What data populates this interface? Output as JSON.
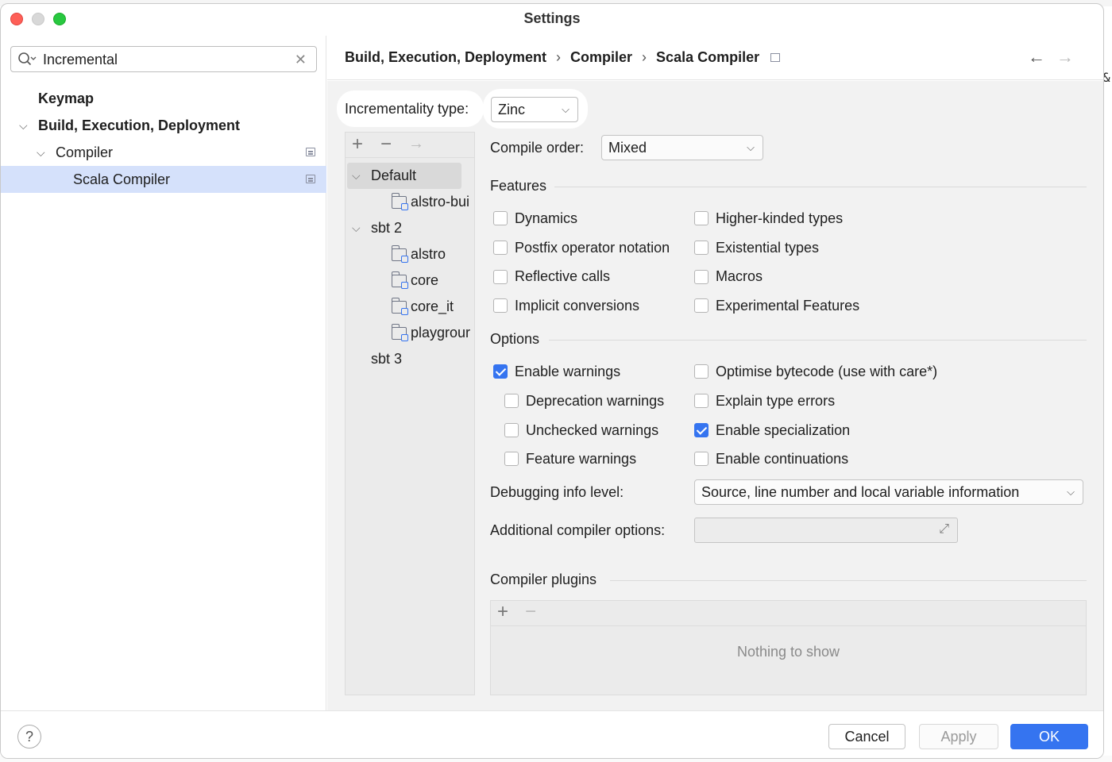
{
  "window": {
    "title": "Settings"
  },
  "search": {
    "value": "Incremental"
  },
  "sidebar": {
    "items": [
      {
        "label": "Keymap"
      },
      {
        "label": "Build, Execution, Deployment"
      },
      {
        "label": "Compiler"
      },
      {
        "label": "Scala Compiler",
        "selected": true
      }
    ]
  },
  "breadcrumb": {
    "items": [
      "Build, Execution, Deployment",
      "Compiler",
      "Scala Compiler"
    ],
    "separator": "›"
  },
  "incrementality": {
    "label": "Incrementality type:",
    "value": "Zinc"
  },
  "profiles": {
    "items": [
      {
        "label": "Default",
        "type": "group",
        "selected": true
      },
      {
        "label": "alstro-bui",
        "type": "module"
      },
      {
        "label": "sbt 2",
        "type": "group"
      },
      {
        "label": "alstro",
        "type": "module"
      },
      {
        "label": "core",
        "type": "module"
      },
      {
        "label": "core_it",
        "type": "module"
      },
      {
        "label": "playgrour",
        "type": "module"
      },
      {
        "label": "sbt 3",
        "type": "group"
      }
    ]
  },
  "compile_order": {
    "label": "Compile order:",
    "value": "Mixed"
  },
  "features": {
    "title": "Features",
    "left": [
      {
        "label": "Dynamics",
        "checked": false
      },
      {
        "label": "Postfix operator notation",
        "checked": false
      },
      {
        "label": "Reflective calls",
        "checked": false
      },
      {
        "label": "Implicit conversions",
        "checked": false
      }
    ],
    "right": [
      {
        "label": "Higher-kinded types",
        "checked": false
      },
      {
        "label": "Existential types",
        "checked": false
      },
      {
        "label": "Macros",
        "checked": false
      },
      {
        "label": "Experimental Features",
        "checked": false
      }
    ]
  },
  "options": {
    "title": "Options",
    "left": [
      {
        "label": "Enable warnings",
        "checked": true
      },
      {
        "label": "Deprecation warnings",
        "checked": false
      },
      {
        "label": "Unchecked warnings",
        "checked": false
      },
      {
        "label": "Feature warnings",
        "checked": false
      }
    ],
    "right": [
      {
        "label": "Optimise bytecode (use with care*)",
        "checked": false
      },
      {
        "label": "Explain type errors",
        "checked": false
      },
      {
        "label": "Enable specialization",
        "checked": true
      },
      {
        "label": "Enable continuations",
        "checked": false
      }
    ]
  },
  "debugging": {
    "label": "Debugging info level:",
    "value": "Source, line number and local variable information"
  },
  "additional_options": {
    "label": "Additional compiler options:",
    "value": ""
  },
  "plugins": {
    "title": "Compiler plugins",
    "empty_text": "Nothing to show"
  },
  "footer": {
    "help": "?",
    "cancel": "Cancel",
    "apply": "Apply",
    "ok": "OK"
  },
  "colors": {
    "accent": "#3574f0",
    "selection": "#d5e1fb"
  }
}
